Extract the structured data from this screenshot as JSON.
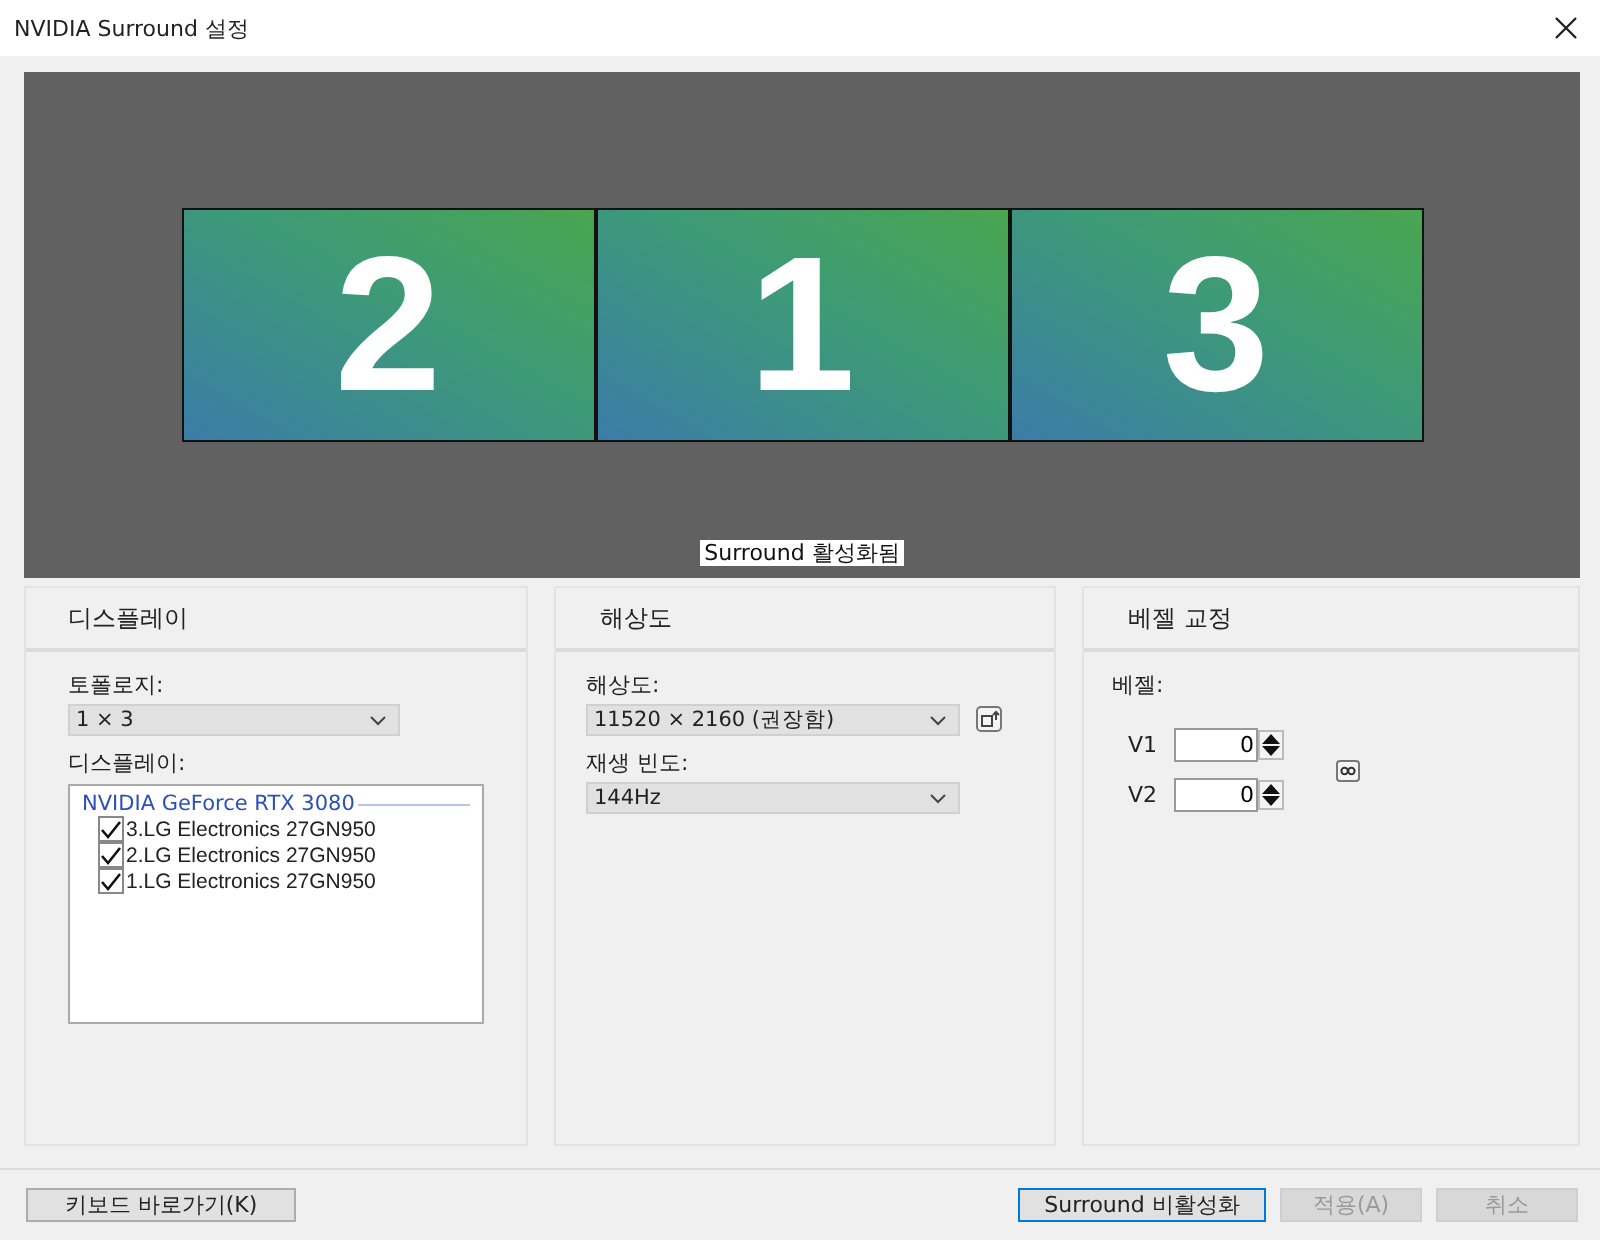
{
  "window": {
    "title": "NVIDIA Surround 설정"
  },
  "preview": {
    "monitors": [
      {
        "label": "2"
      },
      {
        "label": "1"
      },
      {
        "label": "3"
      }
    ],
    "status": "Surround 활성화됨"
  },
  "display_panel": {
    "title": "디스플레이",
    "topology_label": "토폴로지:",
    "topology_value": "1 × 3",
    "displays_label": "디스플레이:",
    "gpu": "NVIDIA GeForce RTX 3080",
    "displays": [
      {
        "name": "3.LG Electronics 27GN950",
        "checked": true
      },
      {
        "name": "2.LG Electronics 27GN950",
        "checked": true
      },
      {
        "name": "1.LG Electronics 27GN950",
        "checked": true
      }
    ]
  },
  "resolution_panel": {
    "title": "해상도",
    "resolution_label": "해상도:",
    "resolution_value": "11520 × 2160 (권장함)",
    "refresh_label": "재생 빈도:",
    "refresh_value": "144Hz"
  },
  "bezel_panel": {
    "title": "베젤 교정",
    "bezel_label": "베젤:",
    "fields": [
      {
        "label": "V1",
        "value": "0"
      },
      {
        "label": "V2",
        "value": "0"
      }
    ]
  },
  "buttons": [
    {
      "label": "키보드 바로가기(K)",
      "disabled": false,
      "focused": false
    },
    {
      "label": "Surround 비활성화",
      "disabled": false,
      "focused": true
    },
    {
      "label": "적용(A)",
      "disabled": true,
      "focused": false
    },
    {
      "label": "취소",
      "disabled": true,
      "focused": false
    }
  ]
}
